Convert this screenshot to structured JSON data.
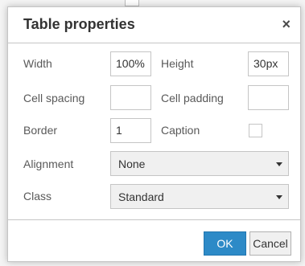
{
  "dialog": {
    "title": "Table properties",
    "close_glyph": "×"
  },
  "fields": {
    "width": {
      "label": "Width",
      "value": "100%"
    },
    "height": {
      "label": "Height",
      "value": "30px"
    },
    "cell_spacing": {
      "label": "Cell spacing",
      "value": ""
    },
    "cell_padding": {
      "label": "Cell padding",
      "value": ""
    },
    "border": {
      "label": "Border",
      "value": "1"
    },
    "caption": {
      "label": "Caption",
      "checked": false
    },
    "alignment": {
      "label": "Alignment",
      "value": "None"
    },
    "class": {
      "label": "Class",
      "value": "Standard"
    }
  },
  "buttons": {
    "ok": "OK",
    "cancel": "Cancel"
  },
  "colors": {
    "primary": "#2d8ac7",
    "border": "#c5c5c5"
  }
}
